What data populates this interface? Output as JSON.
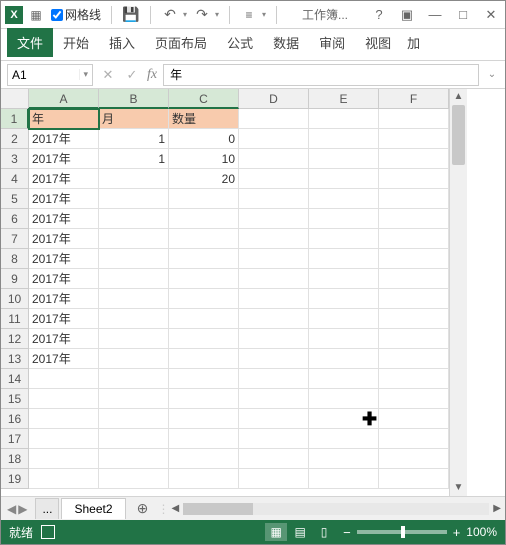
{
  "titlebar": {
    "app_short": "X",
    "gridlines_label": "网格线",
    "title": "工作簿...",
    "help": "?",
    "ribbon_opts": "▣",
    "minimize": "—",
    "maximize": "□",
    "close": "✕"
  },
  "tabs": {
    "file": "文件",
    "home": "开始",
    "insert": "插入",
    "layout": "页面布局",
    "formulas": "公式",
    "data": "数据",
    "review": "审阅",
    "view": "视图",
    "more": "加"
  },
  "formula": {
    "name_box": "A1",
    "cancel": "✕",
    "enter": "✓",
    "fx": "fx",
    "value": "年"
  },
  "grid": {
    "columns": [
      "A",
      "B",
      "C",
      "D",
      "E",
      "F"
    ],
    "rows": 19,
    "active": "A1",
    "selected_cols": [
      "A",
      "B",
      "C"
    ],
    "selected_row": 1,
    "header_row": {
      "A": "年",
      "B": "月",
      "C": "数量"
    },
    "data": [
      {
        "A": "2017年",
        "B": "1",
        "C": "0"
      },
      {
        "A": "2017年",
        "B": "1",
        "C": "10"
      },
      {
        "A": "2017年",
        "B": "",
        "C": "20"
      },
      {
        "A": "2017年"
      },
      {
        "A": "2017年"
      },
      {
        "A": "2017年"
      },
      {
        "A": "2017年"
      },
      {
        "A": "2017年"
      },
      {
        "A": "2017年"
      },
      {
        "A": "2017年"
      },
      {
        "A": "2017年"
      },
      {
        "A": "2017年"
      }
    ]
  },
  "sheets": {
    "hidden": "...",
    "active": "Sheet2",
    "add": "⊕"
  },
  "status": {
    "ready": "就绪",
    "zoom_minus": "−",
    "zoom_plus": "+",
    "zoom_pct": "100%"
  }
}
